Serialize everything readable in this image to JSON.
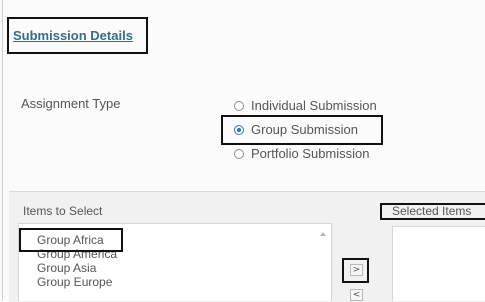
{
  "section": {
    "title": "Submission Details"
  },
  "assignment_type": {
    "label": "Assignment Type",
    "options": [
      {
        "label": "Individual Submission",
        "selected": false
      },
      {
        "label": "Group Submission",
        "selected": true
      },
      {
        "label": "Portfolio Submission",
        "selected": false
      }
    ]
  },
  "items_to_select": {
    "title": "Items to Select",
    "items": [
      "Group Africa",
      "Group America",
      "Group Asia",
      "Group Europe"
    ]
  },
  "move_buttons": {
    "right": ">",
    "left": "<"
  },
  "selected_items": {
    "title": "Selected Items"
  },
  "colors": {
    "link": "#2f6f8f",
    "radio_accent": "#2a79c5",
    "highlight_border": "#111111"
  }
}
